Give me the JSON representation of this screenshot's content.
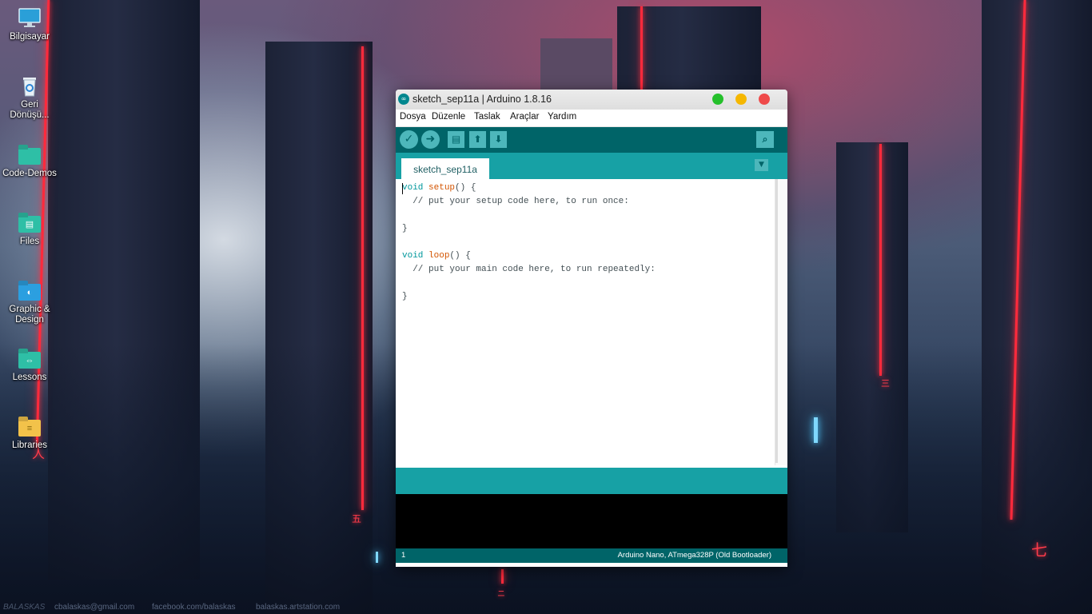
{
  "desktop": {
    "icons": [
      {
        "label": "Bilgisayar",
        "icon": "computer-icon"
      },
      {
        "label": "Geri Dönüşü...",
        "icon": "recycle-bin-icon"
      },
      {
        "label": "Code-Demos",
        "icon": "folder-icon"
      },
      {
        "label": "Files",
        "icon": "folder-icon"
      },
      {
        "label": "Graphic & Design",
        "icon": "folder-icon"
      },
      {
        "label": "Lessons",
        "icon": "folder-icon"
      },
      {
        "label": "Libraries",
        "icon": "folder-icon"
      }
    ],
    "wallpaper_credits": {
      "signature": "BALASKAS",
      "email": "cbalaskas@gmail.com",
      "facebook": "facebook.com/balaskas",
      "artstation": "balaskas.artstation.com"
    },
    "glyphs": [
      "五",
      "三",
      "七",
      "人",
      "ニ"
    ]
  },
  "window": {
    "title": "sketch_sep11a | Arduino 1.8.16",
    "menu": [
      "Dosya",
      "Düzenle",
      "Taslak",
      "Araçlar",
      "Yardım"
    ],
    "tab_label": "sketch_sep11a",
    "code": [
      {
        "kw": "void",
        "fn": "setup",
        "rest": "() {"
      },
      {
        "comment": "  // put your setup code here, to run once:"
      },
      {
        "plain": ""
      },
      {
        "plain": "}"
      },
      {
        "plain": ""
      },
      {
        "kw": "void",
        "fn": "loop",
        "rest": "() {"
      },
      {
        "comment": "  // put your main code here, to run repeatedly:"
      },
      {
        "plain": ""
      },
      {
        "plain": "}"
      }
    ],
    "footer": {
      "line_number": "1",
      "board": "Arduino Nano, ATmega328P (Old Bootloader)"
    },
    "colors": {
      "toolbar": "#006468",
      "tabbar": "#17a1a5",
      "close": "#ef4a4a",
      "minimize": "#f5b700",
      "maximize": "#25c02b"
    }
  }
}
